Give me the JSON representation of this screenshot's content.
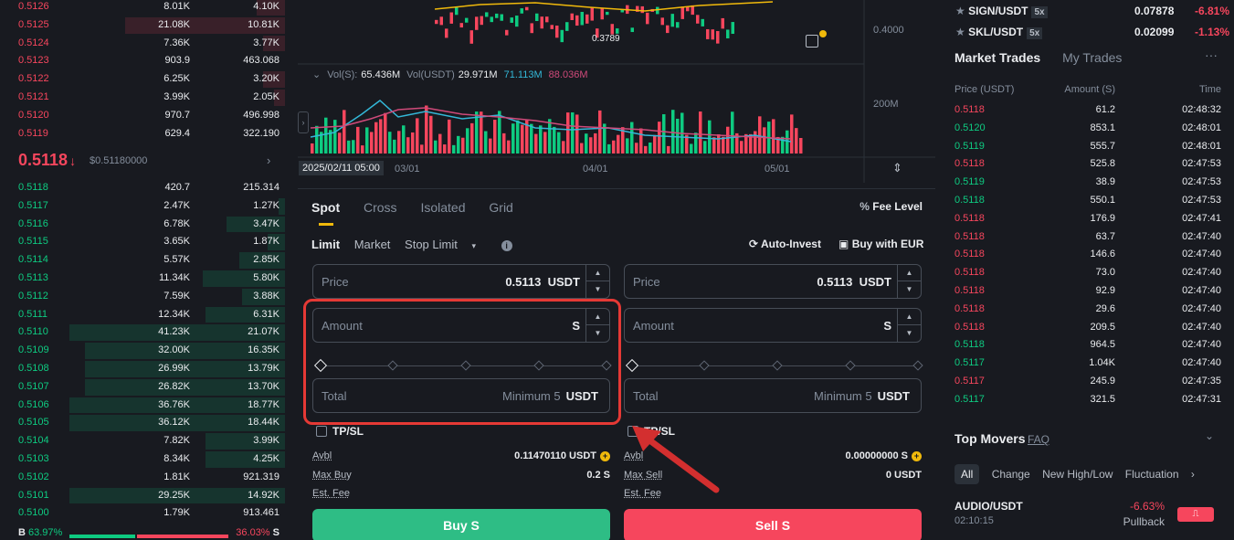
{
  "orderbook": {
    "asks": [
      {
        "price": "0.5126",
        "amount": "8.01K",
        "total": "4.10K",
        "depth": 0.13
      },
      {
        "price": "0.5125",
        "amount": "21.08K",
        "total": "10.81K",
        "depth": 0.74
      },
      {
        "price": "0.5124",
        "amount": "7.36K",
        "total": "3.77K",
        "depth": 0.1
      },
      {
        "price": "0.5123",
        "amount": "903.9",
        "total": "463.068",
        "depth": 0.0
      },
      {
        "price": "0.5122",
        "amount": "6.25K",
        "total": "3.20K",
        "depth": 0.1
      },
      {
        "price": "0.5121",
        "amount": "3.99K",
        "total": "2.05K",
        "depth": 0.05
      },
      {
        "price": "0.5120",
        "amount": "970.7",
        "total": "496.998",
        "depth": 0.0
      },
      {
        "price": "0.5119",
        "amount": "629.4",
        "total": "322.190",
        "depth": 0.0
      }
    ],
    "last_price": "0.5118",
    "last_arrow": "↓",
    "last_usd": "$0.51180000",
    "more_arrow": "›",
    "bids": [
      {
        "price": "0.5118",
        "amount": "420.7",
        "total": "215.314",
        "depth": 0.0
      },
      {
        "price": "0.5117",
        "amount": "2.47K",
        "total": "1.27K",
        "depth": 0.03
      },
      {
        "price": "0.5116",
        "amount": "6.78K",
        "total": "3.47K",
        "depth": 0.27
      },
      {
        "price": "0.5115",
        "amount": "3.65K",
        "total": "1.87K",
        "depth": 0.08
      },
      {
        "price": "0.5114",
        "amount": "5.57K",
        "total": "2.85K",
        "depth": 0.21
      },
      {
        "price": "0.5113",
        "amount": "11.34K",
        "total": "5.80K",
        "depth": 0.38
      },
      {
        "price": "0.5112",
        "amount": "7.59K",
        "total": "3.88K",
        "depth": 0.2
      },
      {
        "price": "0.5111",
        "amount": "12.34K",
        "total": "6.31K",
        "depth": 0.37
      },
      {
        "price": "0.5110",
        "amount": "41.23K",
        "total": "21.07K",
        "depth": 1.0
      },
      {
        "price": "0.5109",
        "amount": "32.00K",
        "total": "16.35K",
        "depth": 0.93
      },
      {
        "price": "0.5108",
        "amount": "26.99K",
        "total": "13.79K",
        "depth": 0.93
      },
      {
        "price": "0.5107",
        "amount": "26.82K",
        "total": "13.70K",
        "depth": 0.93
      },
      {
        "price": "0.5106",
        "amount": "36.76K",
        "total": "18.77K",
        "depth": 1.0
      },
      {
        "price": "0.5105",
        "amount": "36.12K",
        "total": "18.44K",
        "depth": 1.0
      },
      {
        "price": "0.5104",
        "amount": "7.82K",
        "total": "3.99K",
        "depth": 0.37
      },
      {
        "price": "0.5103",
        "amount": "8.34K",
        "total": "4.25K",
        "depth": 0.37
      },
      {
        "price": "0.5102",
        "amount": "1.81K",
        "total": "921.319",
        "depth": 0.0
      },
      {
        "price": "0.5101",
        "amount": "29.25K",
        "total": "14.92K",
        "depth": 1.0
      },
      {
        "price": "0.5100",
        "amount": "1.79K",
        "total": "913.461",
        "depth": 0.0
      }
    ],
    "ratio": {
      "b_label": "B",
      "b_pct": "63.97%",
      "s_pct": "36.03%",
      "s_label": "S",
      "b_value": 63.97
    }
  },
  "chart": {
    "low_label": "0.3789",
    "price_axis": "0.4000",
    "vol_axis": "200M",
    "vol_legend": {
      "vol_s_label": "Vol(S):",
      "vol_s": "65.436M",
      "vol_usdt_label": "Vol(USDT)",
      "vol_usdt": "29.971M",
      "ma1": "71.113M",
      "ma2": "88.036M"
    },
    "date_chip": "2025/02/11 05:00",
    "x_ticks": [
      "03/01",
      "04/01",
      "05/01"
    ],
    "colors": {
      "up": "#0ecb81",
      "down": "#f6465d",
      "ma1": "#33b8d8",
      "ma2": "#d04a7a",
      "ma3": "#f0b90b"
    }
  },
  "form": {
    "tabs": [
      "Spot",
      "Cross",
      "Isolated",
      "Grid"
    ],
    "fee_level": "Fee Level",
    "order_types": [
      "Limit",
      "Market",
      "Stop Limit"
    ],
    "auto_invest": "Auto-Invest",
    "buy_with_eur": "Buy with EUR",
    "buy": {
      "price_label": "Price",
      "price": "0.5113",
      "price_unit": "USDT",
      "amount_label": "Amount",
      "amount_unit": "S",
      "total_label": "Total",
      "total_placeholder": "Minimum 5",
      "total_unit": "USDT",
      "tpsl": "TP/SL",
      "avbl_label": "Avbl",
      "avbl": "0.11470110 USDT",
      "max_label": "Max Buy",
      "max": "0.2 S",
      "fee_label": "Est. Fee",
      "button": "Buy S"
    },
    "sell": {
      "price_label": "Price",
      "price": "0.5113",
      "price_unit": "USDT",
      "amount_label": "Amount",
      "amount_unit": "S",
      "total_label": "Total",
      "total_placeholder": "Minimum 5",
      "total_unit": "USDT",
      "tpsl": "TP/SL",
      "avbl_label": "Avbl",
      "avbl": "0.00000000 S",
      "max_label": "Max Sell",
      "max": "0 USDT",
      "fee_label": "Est. Fee",
      "button": "Sell S"
    }
  },
  "pairs": [
    {
      "name": "SIGN/USDT",
      "lev": "5x",
      "price": "0.07878",
      "change": "-6.81%"
    },
    {
      "name": "SKL/USDT",
      "lev": "5x",
      "price": "0.02099",
      "change": "-1.13%"
    }
  ],
  "trades": {
    "tabs": [
      "Market Trades",
      "My Trades"
    ],
    "headers": [
      "Price (USDT)",
      "Amount (S)",
      "Time"
    ],
    "rows": [
      {
        "p": "0.5118",
        "a": "61.2",
        "t": "02:48:32",
        "side": "sell"
      },
      {
        "p": "0.5120",
        "a": "853.1",
        "t": "02:48:01",
        "side": "buy"
      },
      {
        "p": "0.5119",
        "a": "555.7",
        "t": "02:48:01",
        "side": "buy"
      },
      {
        "p": "0.5118",
        "a": "525.8",
        "t": "02:47:53",
        "side": "sell"
      },
      {
        "p": "0.5119",
        "a": "38.9",
        "t": "02:47:53",
        "side": "buy"
      },
      {
        "p": "0.5118",
        "a": "550.1",
        "t": "02:47:53",
        "side": "buy"
      },
      {
        "p": "0.5118",
        "a": "176.9",
        "t": "02:47:41",
        "side": "sell"
      },
      {
        "p": "0.5118",
        "a": "63.7",
        "t": "02:47:40",
        "side": "sell"
      },
      {
        "p": "0.5118",
        "a": "146.6",
        "t": "02:47:40",
        "side": "sell"
      },
      {
        "p": "0.5118",
        "a": "73.0",
        "t": "02:47:40",
        "side": "sell"
      },
      {
        "p": "0.5118",
        "a": "92.9",
        "t": "02:47:40",
        "side": "sell"
      },
      {
        "p": "0.5118",
        "a": "29.6",
        "t": "02:47:40",
        "side": "sell"
      },
      {
        "p": "0.5118",
        "a": "209.5",
        "t": "02:47:40",
        "side": "sell"
      },
      {
        "p": "0.5118",
        "a": "964.5",
        "t": "02:47:40",
        "side": "buy"
      },
      {
        "p": "0.5117",
        "a": "1.04K",
        "t": "02:47:40",
        "side": "buy"
      },
      {
        "p": "0.5117",
        "a": "245.9",
        "t": "02:47:35",
        "side": "sell"
      },
      {
        "p": "0.5117",
        "a": "321.5",
        "t": "02:47:31",
        "side": "buy"
      }
    ]
  },
  "movers": {
    "title": "Top Movers",
    "faq": "FAQ",
    "tabs": [
      "All",
      "Change",
      "New High/Low",
      "Fluctuation"
    ],
    "row": {
      "pair": "AUDIO/USDT",
      "time": "02:10:15",
      "pct": "-6.63%",
      "label": "Pullback"
    }
  }
}
